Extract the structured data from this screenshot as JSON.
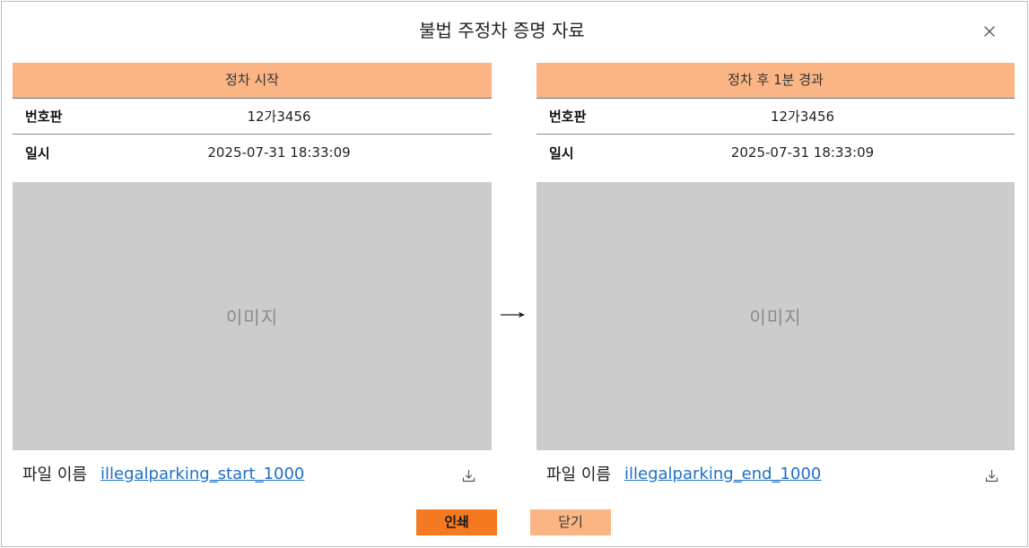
{
  "dialog": {
    "title": "불법 주정차 증명 자료",
    "close_icon": "close-icon"
  },
  "panels": [
    {
      "header": "정차 시작",
      "rows": [
        {
          "label": "번호판",
          "value": "12가3456"
        },
        {
          "label": "일시",
          "value": "2025-07-31 18:33:09"
        }
      ],
      "image_placeholder": "이미지",
      "file_label": "파일 이름",
      "file_name": "illegalparking_start_1000",
      "download_icon": "download-icon"
    },
    {
      "header": "정차 후 1분 경과",
      "rows": [
        {
          "label": "번호판",
          "value": "12가3456"
        },
        {
          "label": "일시",
          "value": "2025-07-31 18:33:09"
        }
      ],
      "image_placeholder": "이미지",
      "file_label": "파일 이름",
      "file_name": "illegalparking_end_1000",
      "download_icon": "download-icon"
    }
  ],
  "transition_icon": "arrow-right-icon",
  "actions": {
    "print_label": "인쇄",
    "close_label": "닫기"
  },
  "colors": {
    "header_bg": "#FBB584",
    "primary_button": "#F47920",
    "secondary_button": "#FBB584",
    "link": "#1F6FC5",
    "image_placeholder": "#CCCCCC"
  }
}
